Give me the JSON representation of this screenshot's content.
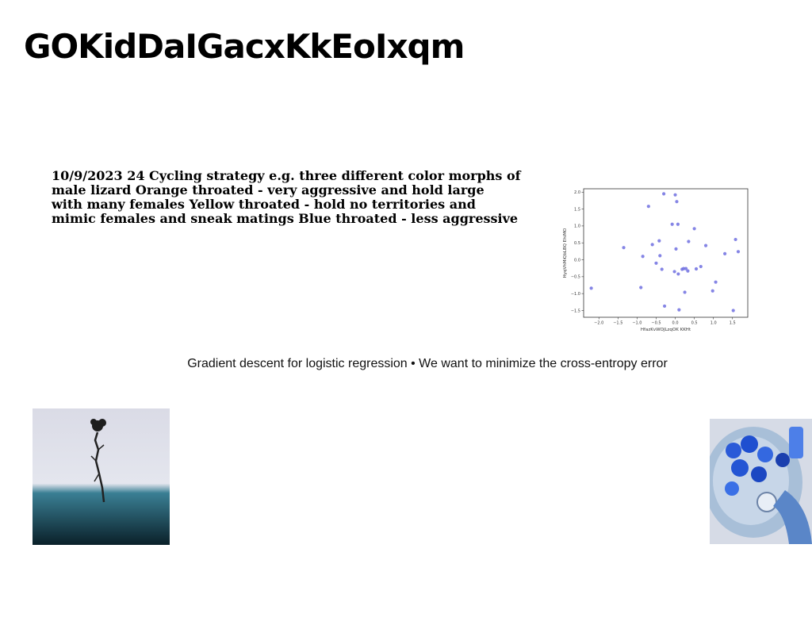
{
  "title": "GOKidDaIGacxKkEoIxqm",
  "body_lines": [
    "10/9/2023 24 Cycling strategy e.g. three different color morphs of",
    "male lizard Orange throated - very aggressive and hold large",
    "with many females Yellow throated - hold no territories and",
    "mimic females and sneak matings Blue throated - less aggressive"
  ],
  "caption": "Gradient descent for logistic regression • We want to minimize the cross-entropy error",
  "images": {
    "tree": "lone tree in fog photo",
    "flowers": "blue flowers on plate photo"
  },
  "chart_data": {
    "type": "scatter",
    "xlabel": "HfazKvWOJLzqOK KKHt",
    "ylabel": "HyqVhMiQbLBQ EhiMO",
    "xlim": [
      -2.4,
      1.9
    ],
    "ylim": [
      -1.7,
      2.1
    ],
    "xticks": [
      -2.0,
      -1.5,
      -1.0,
      -0.5,
      0.0,
      0.5,
      1.0,
      1.5
    ],
    "yticks": [
      -1.5,
      -1.0,
      -0.5,
      0.0,
      0.5,
      1.0,
      1.5,
      2.0
    ],
    "grid": false,
    "color": "#7070e0",
    "series": [
      {
        "points": [
          [
            -2.2,
            -0.84
          ],
          [
            -1.35,
            0.36
          ],
          [
            -0.9,
            -0.82
          ],
          [
            -0.85,
            0.1
          ],
          [
            -0.7,
            1.58
          ],
          [
            -0.6,
            0.45
          ],
          [
            -0.5,
            -0.1
          ],
          [
            -0.42,
            0.56
          ],
          [
            -0.4,
            0.12
          ],
          [
            -0.35,
            -0.28
          ],
          [
            -0.3,
            1.95
          ],
          [
            -0.28,
            -1.37
          ],
          [
            -0.08,
            1.05
          ],
          [
            -0.02,
            -0.35
          ],
          [
            0.0,
            1.92
          ],
          [
            0.02,
            0.32
          ],
          [
            0.04,
            1.72
          ],
          [
            0.07,
            1.05
          ],
          [
            0.08,
            -0.42
          ],
          [
            0.1,
            -1.48
          ],
          [
            0.18,
            -0.28
          ],
          [
            0.22,
            -0.26
          ],
          [
            0.25,
            -0.96
          ],
          [
            0.28,
            -0.26
          ],
          [
            0.33,
            -0.33
          ],
          [
            0.35,
            0.54
          ],
          [
            0.5,
            0.92
          ],
          [
            0.55,
            -0.27
          ],
          [
            0.67,
            -0.2
          ],
          [
            0.8,
            0.42
          ],
          [
            0.98,
            -0.92
          ],
          [
            1.06,
            -0.66
          ],
          [
            1.3,
            0.18
          ],
          [
            1.52,
            -1.5
          ],
          [
            1.58,
            0.6
          ],
          [
            1.65,
            0.24
          ]
        ]
      }
    ]
  }
}
